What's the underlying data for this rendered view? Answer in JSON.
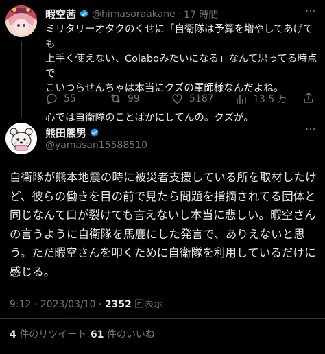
{
  "reply_parent": {
    "display_name": "暇空茜",
    "handle": "@himasoraakane",
    "separator": "·",
    "time": "17 時間",
    "body_line1": "ミリタリーオタクのくせに「自衛隊は予算を増やしてあげても",
    "body_line2": "上手く使えない、Colaboみたいになる」なんて思ってる時点で",
    "body_line3": "こいつらせんちゃは本当にクズの軍師様なんだよね。",
    "body_line4": "心では自衛隊のことばかにしてんの。クズが。",
    "replies": "55",
    "retweets": "99",
    "likes": "5187",
    "views": "13.5 万"
  },
  "main_tweet": {
    "display_name": "熊田熊男",
    "handle": "@yamasan15588510",
    "text_line1": "自衛隊が熊本地震の時に被災者支援している所を取材したけ",
    "text_line2": "ど、彼らの働きを目の前で見たら問題を指摘されてる団体と",
    "text_line3": "同じなんて口が裂けても言えないし本当に悲しい。暇空さん",
    "text_line4": "の言うように自衛隊を馬鹿にした発言で、ありえないと思",
    "text_line5": "う。ただ暇空さんを叩くために自衛隊を利用しているだけに",
    "text_line6": "感じる。",
    "timestamp": "9:12 · 2023/03/10 · ",
    "view_count": "2352",
    "view_label": " 回表示",
    "retweet_count": "4",
    "retweet_label": " 件のリツイート",
    "like_count": "61",
    "like_label": " 件のいいね"
  },
  "colors": {
    "background": "#000000",
    "text_primary": "#e7e9ea",
    "text_secondary": "#71767b",
    "verified_blue": "#1d9bf0"
  },
  "icons": [
    "verified-badge-icon",
    "reply-icon",
    "retweet-icon",
    "like-icon",
    "views-icon"
  ]
}
